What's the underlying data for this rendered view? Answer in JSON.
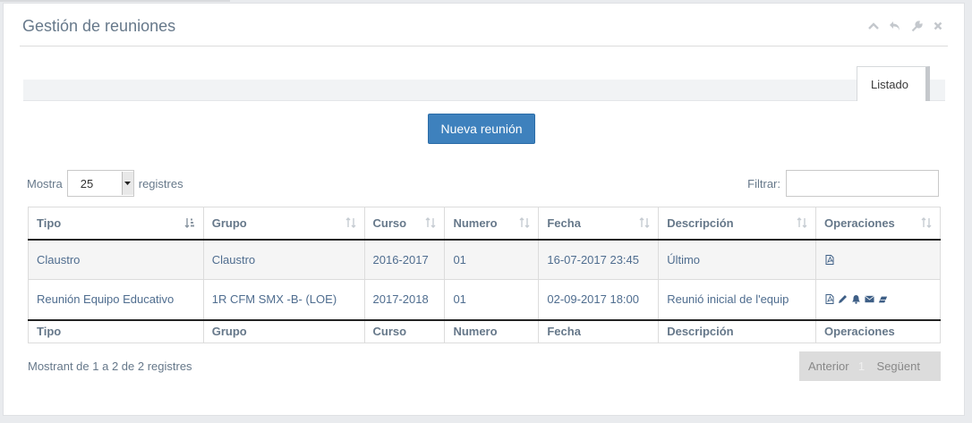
{
  "widget": {
    "title": "Gestión de reuniones",
    "toolbar": [
      {
        "name": "collapse-icon"
      },
      {
        "name": "undo-icon"
      },
      {
        "name": "wrench-icon"
      },
      {
        "name": "close-icon"
      }
    ]
  },
  "tabs": {
    "active_label": "Listado"
  },
  "new_button_label": "Nueva reunión",
  "length_control": {
    "prefix": "Mostra",
    "value": "25",
    "suffix": "registres"
  },
  "filter": {
    "label": "Filtrar:",
    "value": ""
  },
  "table": {
    "columns": [
      "Tipo",
      "Grupo",
      "Curso",
      "Numero",
      "Fecha",
      "Descripción",
      "Operaciones"
    ],
    "rows": [
      {
        "tipo": "Claustro",
        "grupo": "Claustro",
        "curso": "2016-2017",
        "numero": "01",
        "fecha": "16-07-2017 23:45",
        "descripcion": "Último",
        "operations": [
          "pdf-icon"
        ]
      },
      {
        "tipo": "Reunión Equipo Educativo",
        "grupo": "1R CFM SMX -B- (LOE)",
        "curso": "2017-2018",
        "numero": "01",
        "fecha": "02-09-2017 18:00",
        "descripcion": "Reunió inicial de l'equip",
        "operations": [
          "pdf-icon",
          "pencil-icon",
          "bell-icon",
          "envelope-icon",
          "eraser-icon"
        ]
      }
    ]
  },
  "info_text": "Mostrant de 1 a 2 de 2 registres",
  "pagination": {
    "prev": "Anterior",
    "current": "1",
    "next": "Següent"
  },
  "colors": {
    "primary": "#3e81bd",
    "title": "#66788a",
    "cell_text": "#4f6d8f"
  }
}
